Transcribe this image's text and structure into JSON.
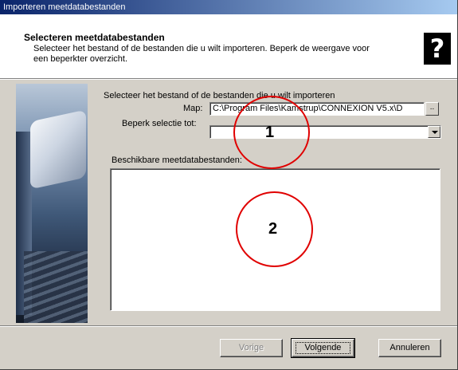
{
  "window": {
    "title": "Importeren meetdatabestanden"
  },
  "header": {
    "title": "Selecteren meetdatabestanden",
    "description": "Selecteer het bestand of de bestanden die u wilt importeren. Beperk de weergave voor een beperkter overzicht.",
    "help_icon": "question-mark-icon"
  },
  "form": {
    "instruction": "Selecteer het bestand of de bestanden die u wilt importeren",
    "map_label": "Map:",
    "map_value": "C:\\Program Files\\Kamstrup\\CONNEXION V5.x\\D",
    "browse_label": "..",
    "filter_label": "Beperk selectie tot:",
    "filter_value": "",
    "list_label": "Beschikbare meetdatabestanden:"
  },
  "buttons": {
    "back": "Vorige",
    "next": "Volgende",
    "cancel": "Annuleren"
  },
  "annotations": [
    {
      "number": "1"
    },
    {
      "number": "2"
    }
  ],
  "colors": {
    "annotation": "#e00000",
    "titlebar": "#0a246a",
    "dialog": "#d4d0c8"
  }
}
